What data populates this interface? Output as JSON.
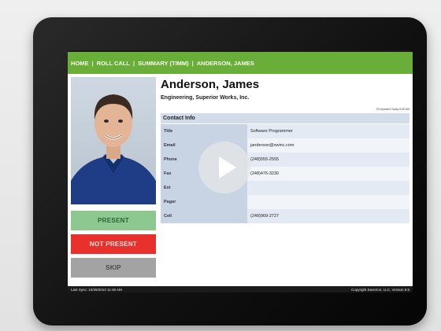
{
  "nav": {
    "home": "HOME",
    "roll_call": "ROLL CALL",
    "summary": "SUMMARY (TIMM)",
    "person": "ANDERSON, JAMES",
    "separator": "|"
  },
  "person": {
    "name": "Anderson, James",
    "company": "Engineering, Superior Works, Inc.",
    "updated": "Rt Updated Today 8:45 AM"
  },
  "contact": {
    "header": "Contact Info",
    "rows": [
      {
        "label": "Title",
        "value": "Software Programmer"
      },
      {
        "label": "Email",
        "value": "janderson@swinc.com"
      },
      {
        "label": "Phone",
        "value": "(248)555-2555"
      },
      {
        "label": "Fax",
        "value": "(248)476-3230"
      },
      {
        "label": "Ext",
        "value": ""
      },
      {
        "label": "Pager",
        "value": ""
      },
      {
        "label": "Cell",
        "value": "(248)969-2727"
      }
    ]
  },
  "actions": {
    "present": "PRESENT",
    "not_present": "NOT PRESENT",
    "skip": "SKIP"
  },
  "footer": {
    "last_sync": "Last Sync: 10/29/2013 11:48 AM",
    "copyright": "Copyright Saverion, LLC. Version 8.5"
  },
  "colors": {
    "nav_green": "#6aae3a",
    "present_green": "#8ec891",
    "not_present_red": "#e8302d",
    "skip_gray": "#a3a3a3"
  },
  "overlay": {
    "icon": "play-icon"
  }
}
